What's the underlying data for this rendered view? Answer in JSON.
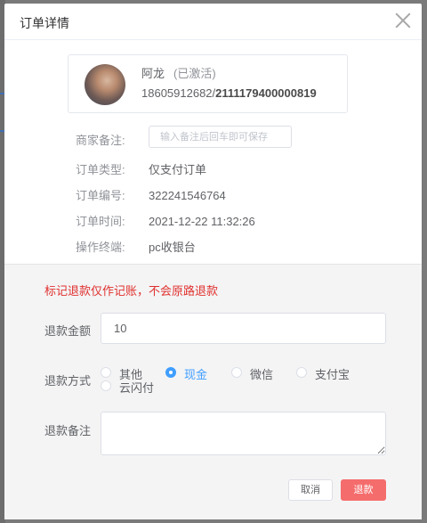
{
  "dialog": {
    "title": "订单详情"
  },
  "user": {
    "name": "阿龙",
    "status": "(已激活)",
    "phone": "18605912682",
    "separator": "/",
    "card_no": "2111179400000819"
  },
  "info": {
    "merchant_note_label": "商家备注:",
    "merchant_note_placeholder": "输入备注后回车即可保存",
    "rows": [
      {
        "label": "订单类型:",
        "value": "仅支付订单"
      },
      {
        "label": "订单编号:",
        "value": "322241546764"
      },
      {
        "label": "订单时间:",
        "value": "2021-12-22 11:32:26"
      },
      {
        "label": "操作终端:",
        "value": "pc收银台"
      }
    ]
  },
  "refund": {
    "warning": "标记退款仅作记账，不会原路退款",
    "amount_label": "退款金额",
    "amount_value": "10",
    "method_label": "退款方式",
    "methods": [
      "其他",
      "现金",
      "微信",
      "支付宝",
      "云闪付"
    ],
    "selected_method": "现金",
    "remark_label": "退款备注",
    "remark_value": "",
    "cancel_label": "取消",
    "submit_label": "退款"
  },
  "colors": {
    "accent": "#409eff",
    "danger": "#f56c6c",
    "warning_text": "#e0312e"
  }
}
